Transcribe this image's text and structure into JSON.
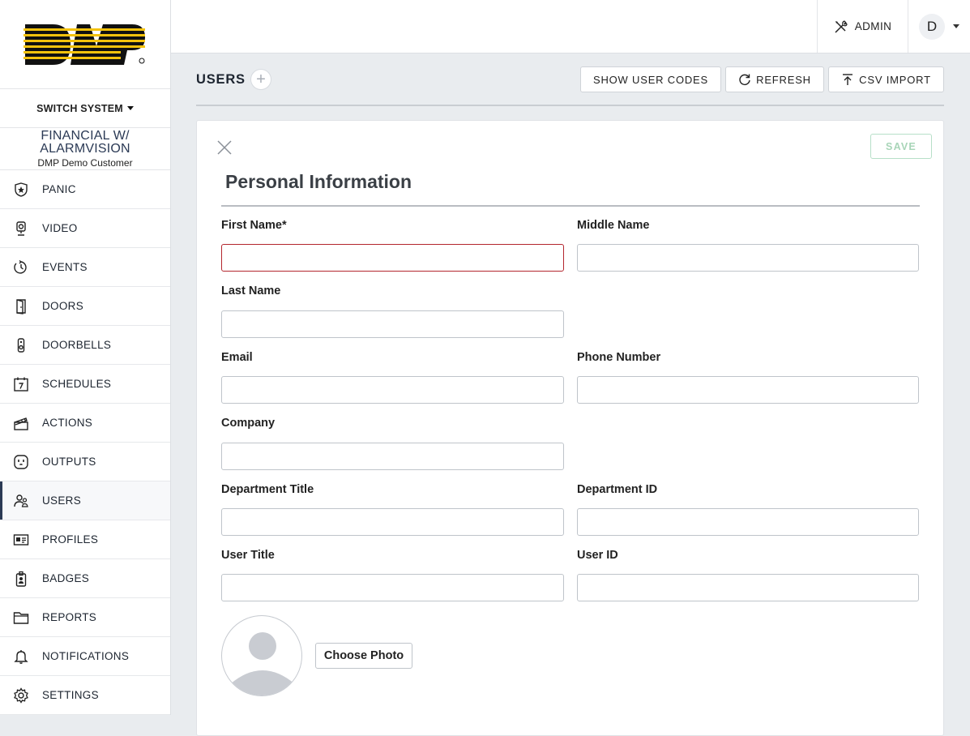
{
  "brand": {
    "logo_text": "DMP",
    "accent": "#f4c20d",
    "primary": "#2b3a55"
  },
  "sidebar": {
    "switch_system_label": "SWITCH SYSTEM",
    "site_name": "FINANCIAL W/ ALARMVISION",
    "site_customer": "DMP Demo Customer",
    "items": [
      {
        "label": "PANIC",
        "icon": "panic-icon"
      },
      {
        "label": "VIDEO",
        "icon": "video-camera-icon"
      },
      {
        "label": "EVENTS",
        "icon": "events-history-icon"
      },
      {
        "label": "DOORS",
        "icon": "door-icon"
      },
      {
        "label": "DOORBELLS",
        "icon": "doorbell-icon"
      },
      {
        "label": "SCHEDULES",
        "icon": "calendar-icon"
      },
      {
        "label": "ACTIONS",
        "icon": "clapperboard-icon"
      },
      {
        "label": "OUTPUTS",
        "icon": "outlet-icon"
      },
      {
        "label": "USERS",
        "icon": "users-icon",
        "active": true
      },
      {
        "label": "PROFILES",
        "icon": "id-card-icon"
      },
      {
        "label": "BADGES",
        "icon": "badge-icon"
      },
      {
        "label": "REPORTS",
        "icon": "folder-icon"
      },
      {
        "label": "NOTIFICATIONS",
        "icon": "bell-icon"
      },
      {
        "label": "SETTINGS",
        "icon": "gear-icon"
      }
    ]
  },
  "header": {
    "admin_label": "ADMIN",
    "user_initial": "D"
  },
  "page": {
    "title": "USERS",
    "add_symbol": "+",
    "buttons": {
      "show_user_codes": "SHOW USER CODES",
      "refresh": "REFRESH",
      "csv_import": "CSV IMPORT"
    }
  },
  "form": {
    "save_label": "SAVE",
    "section_title": "Personal Information",
    "fields": {
      "first_name": {
        "label": "First Name*",
        "value": "",
        "placeholder": ""
      },
      "middle_name": {
        "label": "Middle Name",
        "value": "",
        "placeholder": ""
      },
      "last_name": {
        "label": "Last Name",
        "value": "",
        "placeholder": ""
      },
      "email": {
        "label": "Email",
        "value": "",
        "placeholder": ""
      },
      "phone_number": {
        "label": "Phone Number",
        "value": "",
        "placeholder": ""
      },
      "company": {
        "label": "Company",
        "value": "",
        "placeholder": ""
      },
      "department_title": {
        "label": "Department Title",
        "value": "",
        "placeholder": ""
      },
      "department_id": {
        "label": "Department ID",
        "value": "",
        "placeholder": ""
      },
      "user_title": {
        "label": "User Title",
        "value": "",
        "placeholder": ""
      },
      "user_id": {
        "label": "User ID",
        "value": "",
        "placeholder": ""
      }
    },
    "choose_photo_label": "Choose Photo"
  }
}
